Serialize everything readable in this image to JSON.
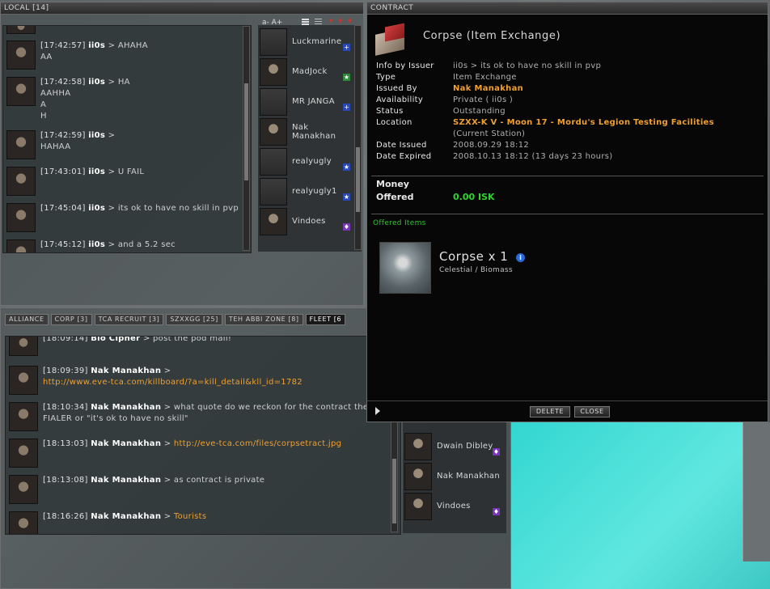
{
  "local": {
    "title": "LOCAL [14]",
    "font_controls": "a- A+",
    "messages": [
      {
        "time": "[17:42:57]",
        "name": "ii0s",
        "sep": " > ",
        "text": "AHAHA\nAA"
      },
      {
        "time": "[17:42:58]",
        "name": "ii0s",
        "sep": " > ",
        "text": "HA\nAAHHA\nA\nH"
      },
      {
        "time": "[17:42:59]",
        "name": "ii0s",
        "sep": " > ",
        "text": "\nHAHAA"
      },
      {
        "time": "[17:43:01]",
        "name": "ii0s",
        "sep": " > ",
        "text": "U FAIL"
      },
      {
        "time": "[17:45:04]",
        "name": "ii0s",
        "sep": " > ",
        "text": "its ok to have no skill in pvp"
      },
      {
        "time": "[17:45:12]",
        "name": "ii0s",
        "sep": " > ",
        "text": "and a 5.2 sec"
      }
    ],
    "members": [
      {
        "name": "Luckmarine",
        "tag": "+",
        "tag_color": "#2a49b8",
        "avatar": "blank"
      },
      {
        "name": "MadJock",
        "tag": "★",
        "tag_color": "#2e8b3a",
        "avatar": "face"
      },
      {
        "name": "MR JANGA",
        "tag": "+",
        "tag_color": "#2a49b8",
        "avatar": "blank"
      },
      {
        "name": "Nak Manakhan",
        "tag": "",
        "tag_color": "",
        "avatar": "face"
      },
      {
        "name": "realyugly",
        "tag": "★",
        "tag_color": "#2a49b8",
        "avatar": "blank"
      },
      {
        "name": "realyugly1",
        "tag": "★",
        "tag_color": "#2a49b8",
        "avatar": "blank"
      },
      {
        "name": "Vindoes",
        "tag": "♦",
        "tag_color": "#7a35b8",
        "avatar": "face"
      }
    ]
  },
  "fleet": {
    "tabs": [
      "ALLIANCE",
      "CORP [3]",
      "TCA RECRUIT [3]",
      "SZXXGG [25]",
      "TEH ABBI ZONE [8]",
      "FLEET [6"
    ],
    "first_line": {
      "time": "[18:09:14]",
      "name": "Bio Cipher",
      "sep": " > ",
      "text": "post the pod mail!"
    },
    "messages": [
      {
        "time": "[18:09:39]",
        "name": "Nak Manakhan",
        "sep": " > ",
        "text": "",
        "link": "http://www.eve-tca.com/killboard/?a=kill_detail&kll_id=1782"
      },
      {
        "time": "[18:10:34]",
        "name": "Nak Manakhan",
        "sep": " > ",
        "text": "what quote do we reckon for the contract then\nFIALER or \"it's ok to have no skill\"",
        "link": ""
      },
      {
        "time": "[18:13:03]",
        "name": "Nak Manakhan",
        "sep": " > ",
        "text": "",
        "link": "http://eve-tca.com/files/corpsetract.jpg"
      },
      {
        "time": "[18:13:08]",
        "name": "Nak Manakhan",
        "sep": " > ",
        "text": "as contract is private",
        "link": ""
      },
      {
        "time": "[18:16:26]",
        "name": "Nak Manakhan",
        "sep": " > ",
        "text": "",
        "link": "Tourists"
      }
    ],
    "members": [
      {
        "name": "Dwain Dibley",
        "tag": "♦",
        "tag_color": "#7a35b8"
      },
      {
        "name": "Nak Manakhan",
        "tag": "",
        "tag_color": ""
      },
      {
        "name": "Vindoes",
        "tag": "♦",
        "tag_color": "#7a35b8"
      }
    ]
  },
  "contract": {
    "header": "CONTRACT",
    "title": "Corpse (Item Exchange)",
    "rows": [
      {
        "key": "Info by Issuer",
        "value": "ii0s > its ok to have no skill in pvp"
      },
      {
        "key": "Type",
        "value": "Item Exchange"
      },
      {
        "key": "Issued By",
        "value": "Nak Manakhan"
      },
      {
        "key": "Availability",
        "value": "Private ( ii0s )"
      },
      {
        "key": "Status",
        "value": "Outstanding"
      },
      {
        "key": "Location",
        "value_link": "SZXX-K V - Moon 17 - Mordu's Legion Testing Facilities",
        "value": " (Current Station)"
      },
      {
        "key": "Date Issued",
        "value": "2008.09.29 18:12"
      },
      {
        "key": "Date Expired",
        "value": "2008.10.13 18:12 (13 days 23 hours)"
      }
    ],
    "money_label": "Money",
    "offered_label": "Offered",
    "money_value": "0.00 ISK",
    "offered_items_label": "Offered Items",
    "item_name": "Corpse x 1",
    "item_category": "Celestial / Biomass",
    "delete_label": "DELETE",
    "close_label": "CLOSE"
  },
  "colors": {
    "accent": "#f0a030",
    "money": "#2fd42f",
    "section": "#2fc42f"
  }
}
